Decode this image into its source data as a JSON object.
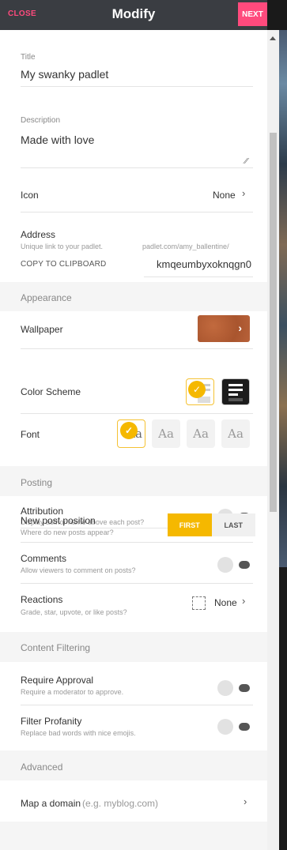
{
  "header": {
    "close_label": "CLOSE",
    "title": "Modify",
    "next_label": "NEXT"
  },
  "title_field": {
    "label": "Title",
    "value": "My swanky padlet"
  },
  "description_field": {
    "label": "Description",
    "value": "Made with love"
  },
  "icon_row": {
    "label": "Icon",
    "value": "None"
  },
  "address": {
    "label": "Address",
    "sub": "Unique link to your padlet.",
    "domain": "padlet.com/amy_ballentine/",
    "copy_label": "COPY TO CLIPBOARD",
    "slug": "kmqeumbyxoknqgn0"
  },
  "appearance": {
    "section_label": "Appearance",
    "wallpaper_label": "Wallpaper",
    "color_scheme_label": "Color Scheme",
    "font_label": "Font",
    "font_options": [
      "Aa",
      "Aa",
      "Aa",
      "Aa"
    ]
  },
  "posting": {
    "section_label": "Posting",
    "attribution": {
      "label": "Attribution",
      "sub": "Display author name above each post?"
    },
    "new_post_position": {
      "label": "New post position",
      "sub": "Where do new posts appear?",
      "first": "FIRST",
      "last": "LAST"
    },
    "comments": {
      "label": "Comments",
      "sub": "Allow viewers to comment on posts?"
    },
    "reactions": {
      "label": "Reactions",
      "sub": "Grade, star, upvote, or like posts?",
      "value": "None"
    }
  },
  "content_filtering": {
    "section_label": "Content Filtering",
    "require_approval": {
      "label": "Require Approval",
      "sub": "Require a moderator to approve."
    },
    "filter_profanity": {
      "label": "Filter Profanity",
      "sub": "Replace bad words with nice emojis."
    }
  },
  "advanced": {
    "section_label": "Advanced",
    "map_domain": {
      "label": "Map a domain",
      "hint": "(e.g. myblog.com)"
    }
  },
  "icons": {
    "chevron": "›",
    "check": "✓",
    "resize": "⁄⁄"
  },
  "colors": {
    "accent": "#ff4a7d",
    "selected": "#f5b800",
    "header_bg": "#3a3d42"
  }
}
